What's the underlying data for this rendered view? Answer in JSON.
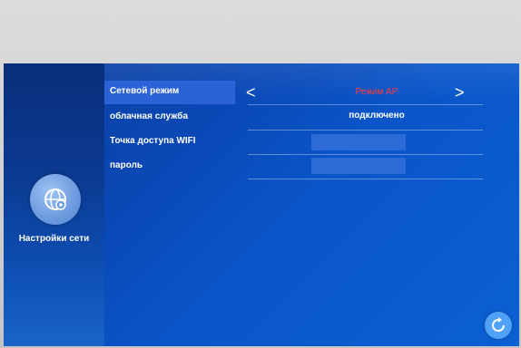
{
  "sidebar": {
    "label": "Настройки сети",
    "icon": "network-settings-icon"
  },
  "rows": [
    {
      "label": "Сетевой режим",
      "value": "Режим AP"
    },
    {
      "label": "облачная служба",
      "value": "подключено"
    },
    {
      "label": "Точка доступа WIFI",
      "value": ""
    },
    {
      "label": "пароль",
      "value": ""
    }
  ],
  "nav": {
    "prev_glyph": "<",
    "next_glyph": ">"
  },
  "colors": {
    "accent": "#2b62d6",
    "mode_value": "#ff3b3b"
  },
  "icons": {
    "back": "back-refresh-icon"
  }
}
